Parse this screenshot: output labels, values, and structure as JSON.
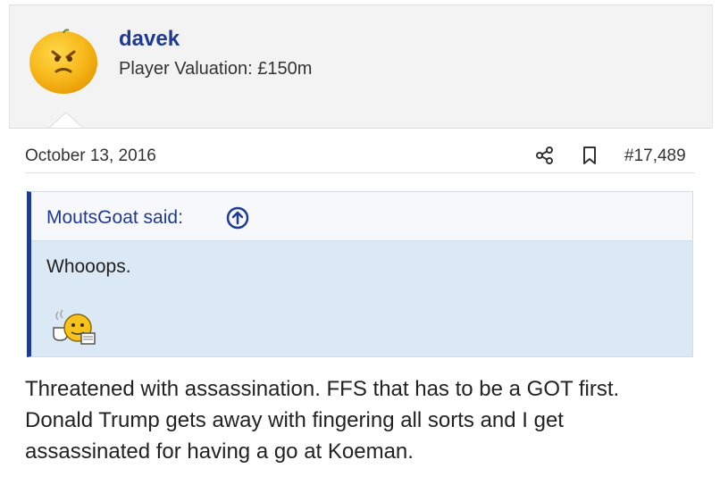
{
  "author": {
    "username": "davek",
    "title": "Player Valuation: £150m",
    "avatar": "orange-face-avatar"
  },
  "post": {
    "date": "October 13, 2016",
    "number": "#17,489",
    "actions": [
      "share-icon",
      "bookmark-icon"
    ]
  },
  "quote": {
    "author_label": "MoutsGoat said:",
    "text": "Whooops.",
    "icon": "arrow-up-circle-icon",
    "smiley": "tea-smiley-icon"
  },
  "body": {
    "lines": [
      "Threatened with assassination. FFS that has to be a GOT first.",
      "Donald Trump gets away with fingering all sorts and I get",
      "assassinated for having a go at Koeman."
    ]
  },
  "colors": {
    "accent": "#1f3a93",
    "quote_bg": "#dbe9f7",
    "header_bg": "#f3f3f3"
  }
}
